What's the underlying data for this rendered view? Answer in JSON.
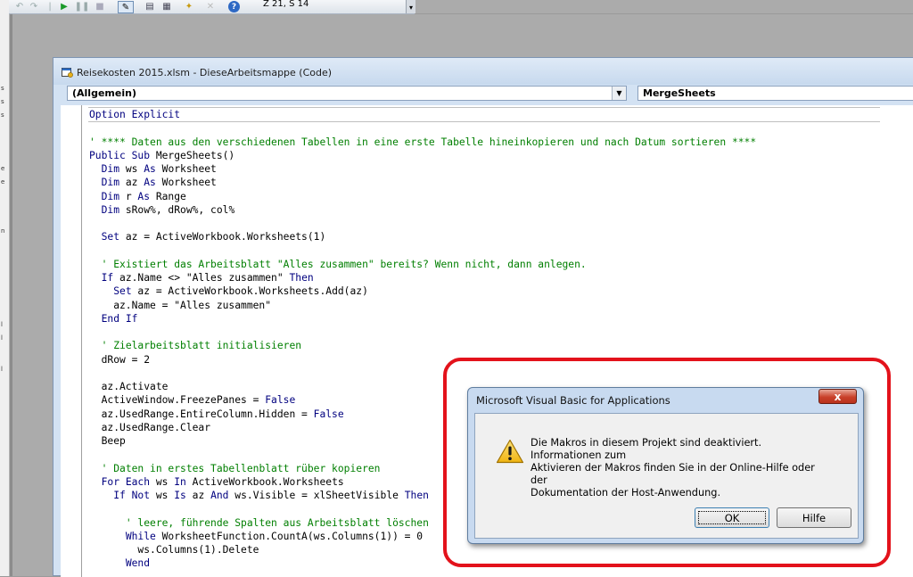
{
  "toolbar": {
    "position_text": "Z 21, S 14"
  },
  "left_strip": {
    "ticks": [
      "s",
      "s",
      "s",
      "e",
      "e",
      "n",
      "l",
      "l",
      "l"
    ]
  },
  "code_window": {
    "title": "Reisekosten 2015.xlsm - DieseArbeitsmappe (Code)",
    "object_combo": "(Allgemein)",
    "procedure_combo": "MergeSheets"
  },
  "code_lines": [
    [
      {
        "t": "kw",
        "s": "Option Explicit"
      }
    ],
    [],
    [
      {
        "t": "cm",
        "s": "' **** Daten aus den verschiedenen Tabellen in eine erste Tabelle hineinkopieren und nach Datum sortieren ****"
      }
    ],
    [
      {
        "t": "kw",
        "s": "Public Sub"
      },
      {
        "t": "n",
        "s": " MergeSheets()"
      }
    ],
    [
      {
        "t": "n",
        "s": "  "
      },
      {
        "t": "kw",
        "s": "Dim"
      },
      {
        "t": "n",
        "s": " ws "
      },
      {
        "t": "kw",
        "s": "As"
      },
      {
        "t": "n",
        "s": " Worksheet"
      }
    ],
    [
      {
        "t": "n",
        "s": "  "
      },
      {
        "t": "kw",
        "s": "Dim"
      },
      {
        "t": "n",
        "s": " az "
      },
      {
        "t": "kw",
        "s": "As"
      },
      {
        "t": "n",
        "s": " Worksheet"
      }
    ],
    [
      {
        "t": "n",
        "s": "  "
      },
      {
        "t": "kw",
        "s": "Dim"
      },
      {
        "t": "n",
        "s": " r "
      },
      {
        "t": "kw",
        "s": "As"
      },
      {
        "t": "n",
        "s": " Range"
      }
    ],
    [
      {
        "t": "n",
        "s": "  "
      },
      {
        "t": "kw",
        "s": "Dim"
      },
      {
        "t": "n",
        "s": " sRow%, dRow%, col%"
      }
    ],
    [],
    [
      {
        "t": "n",
        "s": "  "
      },
      {
        "t": "kw",
        "s": "Set"
      },
      {
        "t": "n",
        "s": " az = ActiveWorkbook.Worksheets(1)"
      }
    ],
    [],
    [
      {
        "t": "n",
        "s": "  "
      },
      {
        "t": "cm",
        "s": "' Existiert das Arbeitsblatt \"Alles zusammen\" bereits? Wenn nicht, dann anlegen."
      }
    ],
    [
      {
        "t": "n",
        "s": "  "
      },
      {
        "t": "kw",
        "s": "If"
      },
      {
        "t": "n",
        "s": " az.Name <> \"Alles zusammen\" "
      },
      {
        "t": "kw",
        "s": "Then"
      }
    ],
    [
      {
        "t": "n",
        "s": "    "
      },
      {
        "t": "kw",
        "s": "Set"
      },
      {
        "t": "n",
        "s": " az = ActiveWorkbook.Worksheets.Add(az)"
      }
    ],
    [
      {
        "t": "n",
        "s": "    az.Name = \"Alles zusammen\""
      }
    ],
    [
      {
        "t": "n",
        "s": "  "
      },
      {
        "t": "kw",
        "s": "End If"
      }
    ],
    [],
    [
      {
        "t": "n",
        "s": "  "
      },
      {
        "t": "cm",
        "s": "' Zielarbeitsblatt initialisieren"
      }
    ],
    [
      {
        "t": "n",
        "s": "  dRow = 2"
      }
    ],
    [],
    [
      {
        "t": "n",
        "s": "  az.Activate"
      }
    ],
    [
      {
        "t": "n",
        "s": "  ActiveWindow.FreezePanes = "
      },
      {
        "t": "kw",
        "s": "False"
      }
    ],
    [
      {
        "t": "n",
        "s": "  az.UsedRange.EntireColumn.Hidden = "
      },
      {
        "t": "kw",
        "s": "False"
      }
    ],
    [
      {
        "t": "n",
        "s": "  az.UsedRange.Clear"
      }
    ],
    [
      {
        "t": "n",
        "s": "  Beep"
      }
    ],
    [],
    [
      {
        "t": "n",
        "s": "  "
      },
      {
        "t": "cm",
        "s": "' Daten in erstes Tabellenblatt rüber kopieren"
      }
    ],
    [
      {
        "t": "n",
        "s": "  "
      },
      {
        "t": "kw",
        "s": "For Each"
      },
      {
        "t": "n",
        "s": " ws "
      },
      {
        "t": "kw",
        "s": "In"
      },
      {
        "t": "n",
        "s": " ActiveWorkbook.Worksheets"
      }
    ],
    [
      {
        "t": "n",
        "s": "    "
      },
      {
        "t": "kw",
        "s": "If Not"
      },
      {
        "t": "n",
        "s": " ws "
      },
      {
        "t": "kw",
        "s": "Is"
      },
      {
        "t": "n",
        "s": " az "
      },
      {
        "t": "kw",
        "s": "And"
      },
      {
        "t": "n",
        "s": " ws.Visible = xlSheetVisible "
      },
      {
        "t": "kw",
        "s": "Then"
      }
    ],
    [],
    [
      {
        "t": "n",
        "s": "      "
      },
      {
        "t": "cm",
        "s": "' leere, führende Spalten aus Arbeitsblatt löschen"
      }
    ],
    [
      {
        "t": "n",
        "s": "      "
      },
      {
        "t": "kw",
        "s": "While"
      },
      {
        "t": "n",
        "s": " WorksheetFunction.CountA(ws.Columns(1)) = 0"
      }
    ],
    [
      {
        "t": "n",
        "s": "        ws.Columns(1).Delete"
      }
    ],
    [
      {
        "t": "n",
        "s": "      "
      },
      {
        "t": "kw",
        "s": "Wend"
      }
    ]
  ],
  "dialog": {
    "title": "Microsoft Visual Basic for Applications",
    "close_label": "x",
    "message_lines": [
      "Die Makros in diesem Projekt sind deaktiviert. Informationen zum",
      "Aktivieren der Makros finden Sie in der Online-Hilfe oder der",
      "Dokumentation der Host-Anwendung."
    ],
    "ok_label": "OK",
    "help_label": "Hilfe"
  },
  "colors": {
    "keyword": "#00007f",
    "comment": "#007f00",
    "annotation": "#e3121b"
  }
}
